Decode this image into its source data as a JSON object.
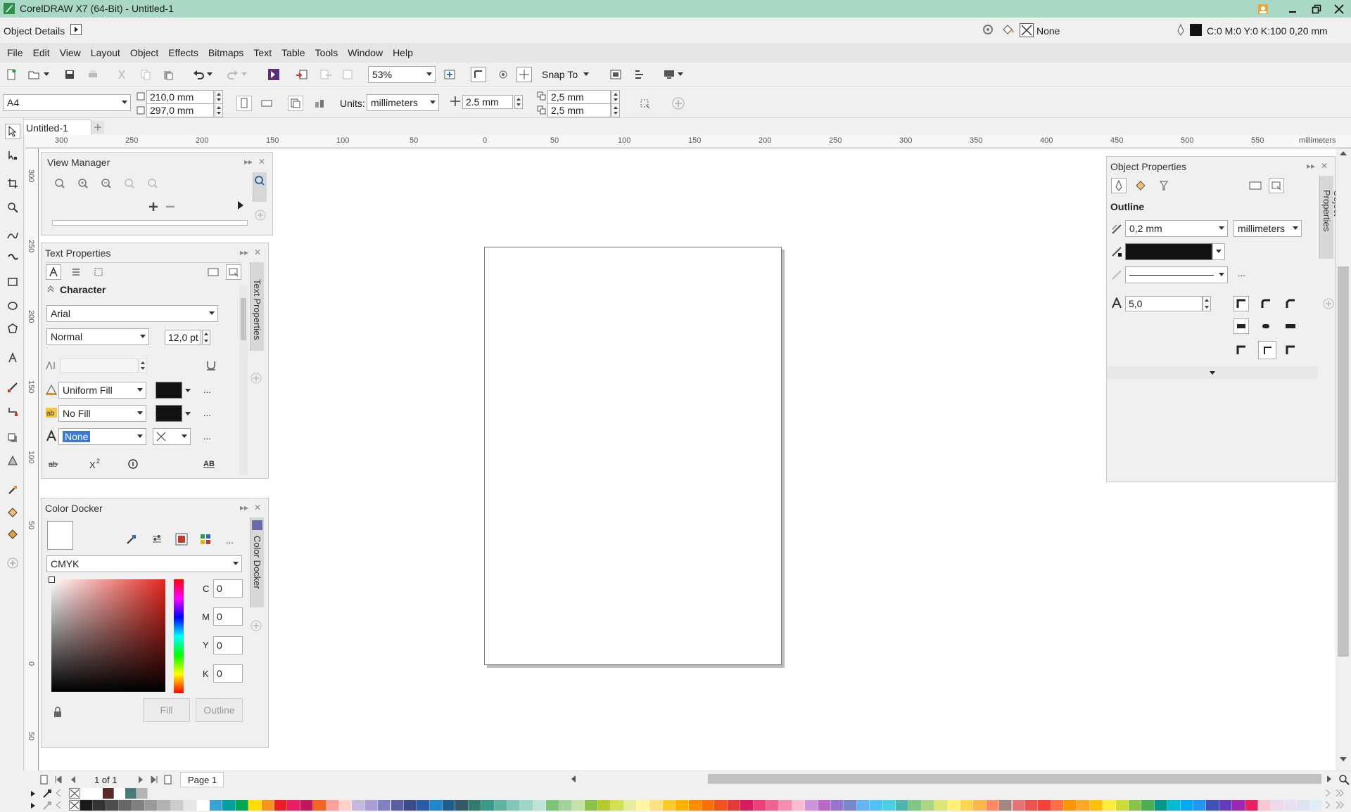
{
  "app": {
    "title": "CorelDRAW X7 (64-Bit) - Untitled-1"
  },
  "odbar": {
    "label": "Object Details",
    "fill_label": "None",
    "outline_label": "C:0 M:0 Y:0 K:100  0,20 mm"
  },
  "menu": [
    "File",
    "Edit",
    "View",
    "Layout",
    "Object",
    "Effects",
    "Bitmaps",
    "Text",
    "Table",
    "Tools",
    "Window",
    "Help"
  ],
  "toolbar": {
    "zoom": "53%",
    "snap": "Snap To"
  },
  "propbar": {
    "page_size": "A4",
    "width": "210,0 mm",
    "height": "297,0 mm",
    "units_label": "Units:",
    "units": "millimeters",
    "nudge": "2.5 mm",
    "dup_x": "2,5 mm",
    "dup_y": "2,5 mm"
  },
  "tabs": {
    "doc": "Untitled-1"
  },
  "ruler": {
    "h": [
      "300",
      "250",
      "200",
      "150",
      "100",
      "50",
      "0",
      "50",
      "100",
      "150",
      "200",
      "250",
      "300",
      "350",
      "400",
      "450",
      "500",
      "550"
    ],
    "h_unit": "millimeters",
    "v": [
      "300",
      "250",
      "200",
      "150",
      "100",
      "50",
      "0",
      "50"
    ],
    "v_unit": "millimeters"
  },
  "view_manager": {
    "title": "View Manager"
  },
  "text_props": {
    "title": "Text Properties",
    "section": "Character",
    "font": "Arial",
    "style": "Normal",
    "size": "12,0 pt",
    "fill": "Uniform Fill",
    "bg": "No Fill",
    "outline": "None",
    "sidetab": "Text Properties"
  },
  "color_docker": {
    "title": "Color Docker",
    "model": "CMYK",
    "c_label": "C",
    "c": "0",
    "m_label": "M",
    "m": "0",
    "y_label": "Y",
    "y": "0",
    "k_label": "K",
    "k": "0",
    "fill_btn": "Fill",
    "outline_btn": "Outline",
    "sidetab": "Color Docker"
  },
  "obj_props": {
    "title": "Object Properties",
    "section": "Outline",
    "width": "0,2 mm",
    "units": "millimeters",
    "miter": "5,0",
    "sidetab": "Object Properties"
  },
  "status": {
    "pages": "1 of 1",
    "page_tab": "Page 1"
  },
  "palette": {
    "row1": [
      "#ffffff",
      "#ffffff",
      "#5a2a2a",
      "#ffffff",
      "#4a7a7a",
      "#b5b5b5"
    ],
    "row2": [
      "#1a1a1a",
      "#333333",
      "#4d4d4d",
      "#666666",
      "#808080",
      "#999999",
      "#b3b3b3",
      "#cccccc",
      "#e6e6e6",
      "#ffffff",
      "#3aa0d8",
      "#00a0a0",
      "#00a651",
      "#ffde00",
      "#f7941d",
      "#ed1c24",
      "#e91e63",
      "#c2185b",
      "#f26522",
      "#f9a19a",
      "#fdd0c8",
      "#c7b8e0",
      "#a99fd3",
      "#7e82c2",
      "#5c5ea3",
      "#3b4a8a",
      "#2b5aa6",
      "#1e88c8",
      "#1d5f8a",
      "#345a6a",
      "#2e7d6e",
      "#3a9a8a",
      "#5fb3a3",
      "#7fc7b7",
      "#9ed6c7",
      "#bfe3d7",
      "#7cc576",
      "#a3d39c",
      "#c5e1a5",
      "#8bc34a",
      "#b5cc2e",
      "#d4e157",
      "#e6ee9c",
      "#fff59d",
      "#ffe082",
      "#ffca28",
      "#ffb300",
      "#ff8f00",
      "#ff6f00",
      "#f4511e",
      "#e53935",
      "#d81b60",
      "#ec407a",
      "#f06292",
      "#f48fb1",
      "#f8bbd0",
      "#ce93d8",
      "#ba68c8",
      "#9575cd",
      "#7986cb",
      "#64b5f6",
      "#4fc3f7",
      "#4dd0e1",
      "#4db6ac",
      "#81c784",
      "#aed581",
      "#dce775",
      "#fff176",
      "#ffd54f",
      "#ffb74d",
      "#ff8a65",
      "#a1887f",
      "#e57373",
      "#ef5350",
      "#f44336",
      "#ff7043",
      "#ff9800",
      "#ffa726",
      "#ffc107",
      "#ffeb3b",
      "#cddc39",
      "#8bc34a",
      "#4caf50",
      "#009688",
      "#00bcd4",
      "#03a9f4",
      "#2196f3",
      "#3f51b5",
      "#673ab7",
      "#9c27b0",
      "#e91e63",
      "#f8c8d0",
      "#f0d8e8",
      "#e8e0f0",
      "#dde4f0",
      "#e0eef8"
    ]
  }
}
